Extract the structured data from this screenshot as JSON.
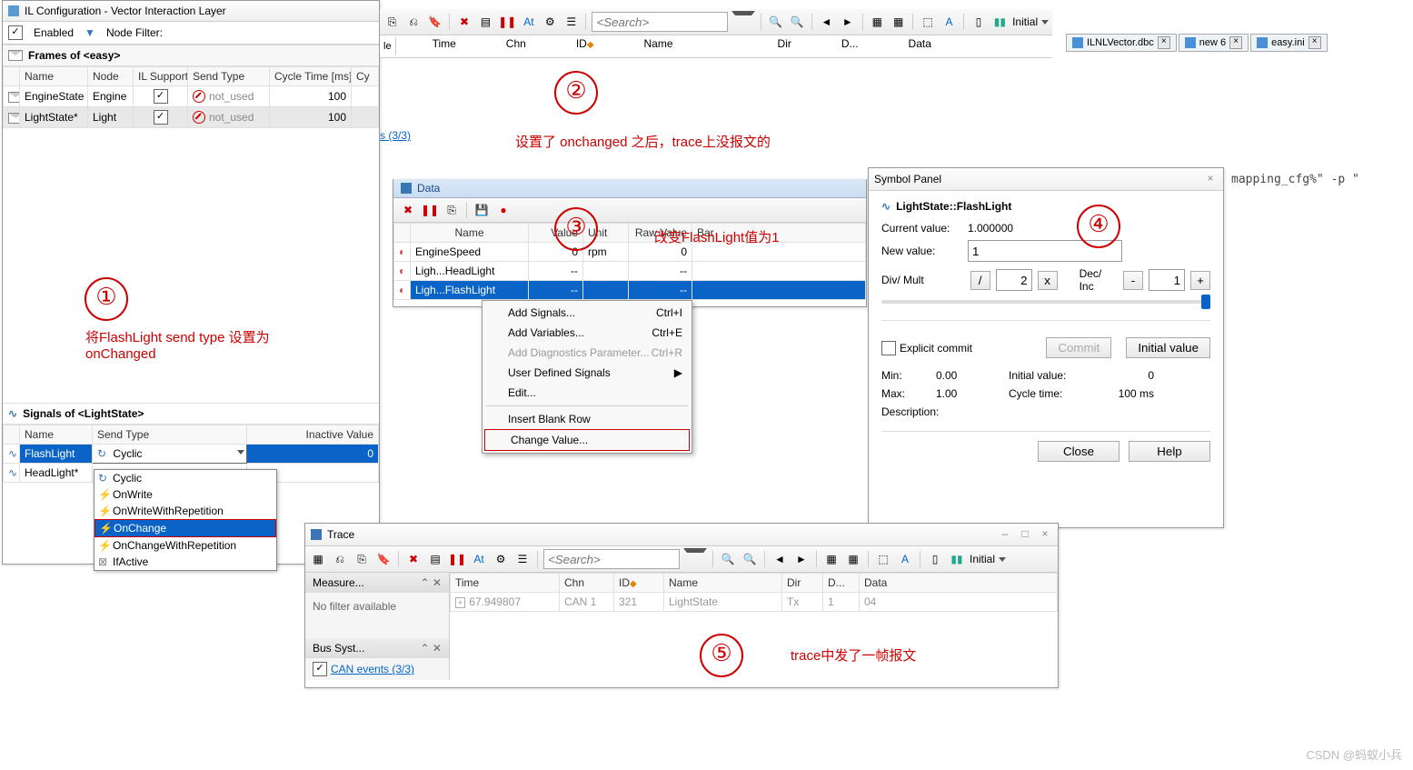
{
  "ilconfig": {
    "title": "IL Configuration - Vector Interaction Layer",
    "enabled_label": "Enabled",
    "nodefilter_label": "Node Filter:",
    "frames_title": "Frames of <easy>",
    "cols": {
      "name": "Name",
      "node": "Node",
      "il": "IL Support",
      "sendtype": "Send Type",
      "cycle": "Cycle Time [ms]",
      "cy2": "Cy"
    },
    "rows": [
      {
        "name": "EngineState",
        "node": "Engine",
        "sendtype": "not_used",
        "cycle": "100"
      },
      {
        "name": "LightState*",
        "node": "Light",
        "sendtype": "not_used",
        "cycle": "100"
      }
    ],
    "signals_title": "Signals of <LightState>",
    "sigcols": {
      "name": "Name",
      "st": "Send Type",
      "iv": "Inactive Value"
    },
    "sigrows": [
      {
        "name": "FlashLight",
        "st": "Cyclic",
        "iv": "0"
      },
      {
        "name": "HeadLight*",
        "st": "",
        "iv": ""
      }
    ],
    "sendtype_options": [
      "Cyclic",
      "OnWrite",
      "OnWriteWithRepetition",
      "OnChange",
      "OnChangeWithRepetition",
      "IfActive"
    ]
  },
  "annotations": {
    "n1_text": "将FlashLight send type 设置为onChanged",
    "n2_text": "设置了 onchanged 之后，trace上没报文的",
    "n3_text": "改变FlashLight值为1",
    "n5_text": "trace中发了一帧报文"
  },
  "tracetop": {
    "search_placeholder": "<Search>",
    "initial_label": "Initial",
    "cols": {
      "time": "Time",
      "chn": "Chn",
      "id": "ID",
      "name": "Name",
      "dir": "Dir",
      "d": "D...",
      "data": "Data"
    },
    "link": "s (3/3)"
  },
  "filetabs": [
    {
      "label": "ILNLVector.dbc"
    },
    {
      "label": "new 6"
    },
    {
      "label": "easy.ini"
    }
  ],
  "rightsnippet": "mapping_cfg%\" -p \"",
  "data_panel": {
    "title": "Data",
    "cols": {
      "name": "Name",
      "value": "Value",
      "unit": "Unit",
      "raw": "Raw Value",
      "bar": "Bar"
    },
    "rows": [
      {
        "name": "EngineSpeed",
        "value": "0",
        "unit": "rpm",
        "raw": "0"
      },
      {
        "name": "Ligh...HeadLight",
        "value": "--",
        "unit": "",
        "raw": "--"
      },
      {
        "name": "Ligh...FlashLight",
        "value": "--",
        "unit": "",
        "raw": "--"
      }
    ]
  },
  "context_menu": {
    "items": [
      {
        "label": "Add Signals...",
        "sc": "Ctrl+I"
      },
      {
        "label": "Add Variables...",
        "sc": "Ctrl+E"
      },
      {
        "label": "Add Diagnostics Parameter...",
        "sc": "Ctrl+R",
        "dis": true
      },
      {
        "label": "User Defined Signals",
        "sub": true
      },
      {
        "label": "Edit...",
        "sep_after": true
      },
      {
        "label": "Insert Blank Row"
      },
      {
        "label": "Change Value...",
        "boxed": true
      }
    ]
  },
  "symbol": {
    "title": "Symbol Panel",
    "signal": "LightState::FlashLight",
    "curval_lbl": "Current value:",
    "curval": "1.000000",
    "newval_lbl": "New value:",
    "newval": "1",
    "divmult_lbl": "Div/ Mult",
    "divmult_val": "2",
    "decinc_lbl": "Dec/ Inc",
    "decinc_val": "1",
    "explicit_lbl": "Explicit commit",
    "commit_btn": "Commit",
    "initval_btn": "Initial value",
    "min_lbl": "Min:",
    "min": "0.00",
    "max_lbl": "Max:",
    "max": "1.00",
    "initv_lbl": "Initial value:",
    "initv": "0",
    "cycle_lbl": "Cycle time:",
    "cycle": "100 ms",
    "desc_lbl": "Description:",
    "close_btn": "Close",
    "help_btn": "Help"
  },
  "tracebot": {
    "title": "Trace",
    "search_placeholder": "<Search>",
    "initial_label": "Initial",
    "cols": {
      "time": "Time",
      "chn": "Chn",
      "id": "ID",
      "name": "Name",
      "dir": "Dir",
      "d": "D...",
      "data": "Data"
    },
    "row": {
      "time": "67.949807",
      "chn": "CAN 1",
      "id": "321",
      "name": "LightState",
      "dir": "Tx",
      "d": "1",
      "data": "04"
    },
    "measure": "Measure...",
    "nofilter": "No filter available",
    "bussys": "Bus Syst...",
    "canevents": "CAN events (3/3)"
  },
  "watermark": "CSDN @蚂蚁小兵"
}
